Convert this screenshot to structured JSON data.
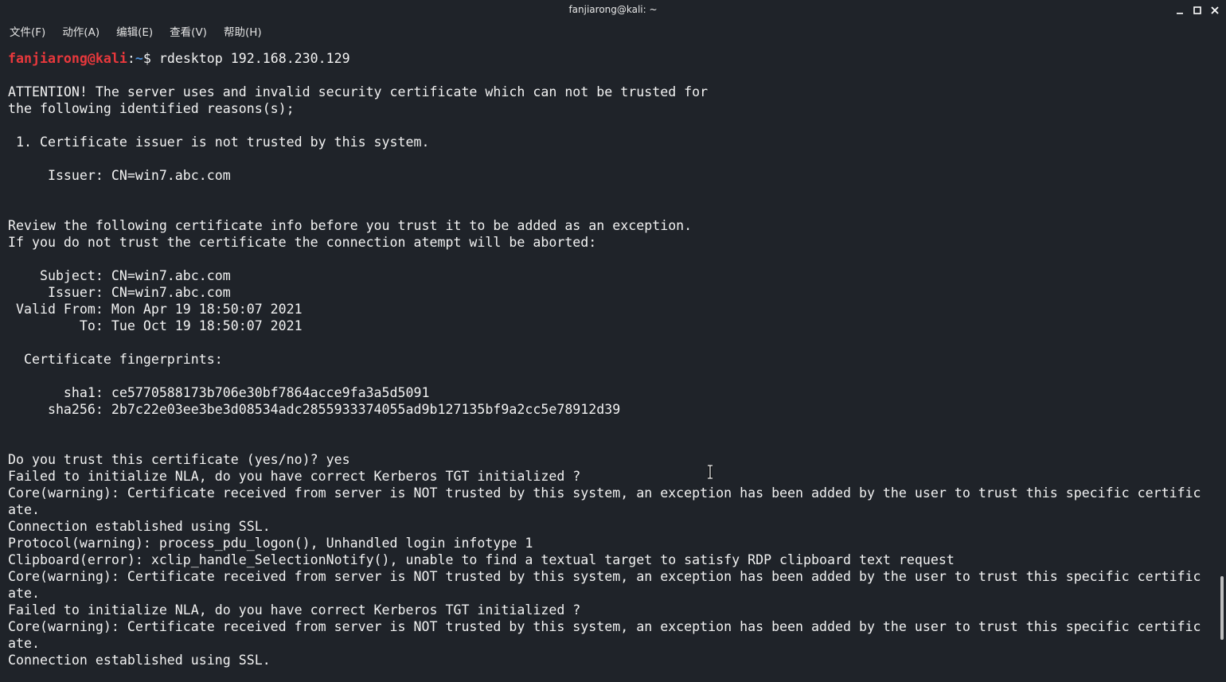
{
  "window": {
    "title": "fanjiarong@kali: ~"
  },
  "menubar": {
    "items": [
      "文件(F)",
      "动作(A)",
      "编辑(E)",
      "查看(V)",
      "帮助(H)"
    ]
  },
  "prompt": {
    "user_host": "fanjiarong@kali",
    "separator": ":",
    "path": "~",
    "dollar": "$ ",
    "command": "rdesktop 192.168.230.129"
  },
  "terminal": {
    "lines": [
      "",
      "ATTENTION! The server uses and invalid security certificate which can not be trusted for",
      "the following identified reasons(s);",
      "",
      " 1. Certificate issuer is not trusted by this system.",
      "",
      "     Issuer: CN=win7.abc.com",
      "",
      "",
      "Review the following certificate info before you trust it to be added as an exception.",
      "If you do not trust the certificate the connection atempt will be aborted:",
      "",
      "    Subject: CN=win7.abc.com",
      "     Issuer: CN=win7.abc.com",
      " Valid From: Mon Apr 19 18:50:07 2021",
      "         To: Tue Oct 19 18:50:07 2021",
      "",
      "  Certificate fingerprints:",
      "",
      "       sha1: ce5770588173b706e30bf7864acce9fa3a5d5091",
      "     sha256: 2b7c22e03ee3be3d08534adc2855933374055ad9b127135bf9a2cc5e78912d39",
      "",
      "",
      "Do you trust this certificate (yes/no)? yes",
      "Failed to initialize NLA, do you have correct Kerberos TGT initialized ?",
      "Core(warning): Certificate received from server is NOT trusted by this system, an exception has been added by the user to trust this specific certific",
      "ate.",
      "Connection established using SSL.",
      "Protocol(warning): process_pdu_logon(), Unhandled login infotype 1",
      "Clipboard(error): xclip_handle_SelectionNotify(), unable to find a textual target to satisfy RDP clipboard text request",
      "Core(warning): Certificate received from server is NOT trusted by this system, an exception has been added by the user to trust this specific certific",
      "ate.",
      "Failed to initialize NLA, do you have correct Kerberos TGT initialized ?",
      "Core(warning): Certificate received from server is NOT trusted by this system, an exception has been added by the user to trust this specific certific",
      "ate.",
      "Connection established using SSL."
    ]
  },
  "icons": {
    "minimize": "minimize-icon",
    "maximize": "maximize-icon",
    "close": "close-icon",
    "text_cursor": "i-beam-cursor-icon"
  },
  "colors": {
    "background": "#1f2329",
    "text": "#f2f2f2",
    "prompt_user": "#e8383c",
    "prompt_path": "#4c8fd6",
    "scrollbar": "#bdbdbd"
  }
}
